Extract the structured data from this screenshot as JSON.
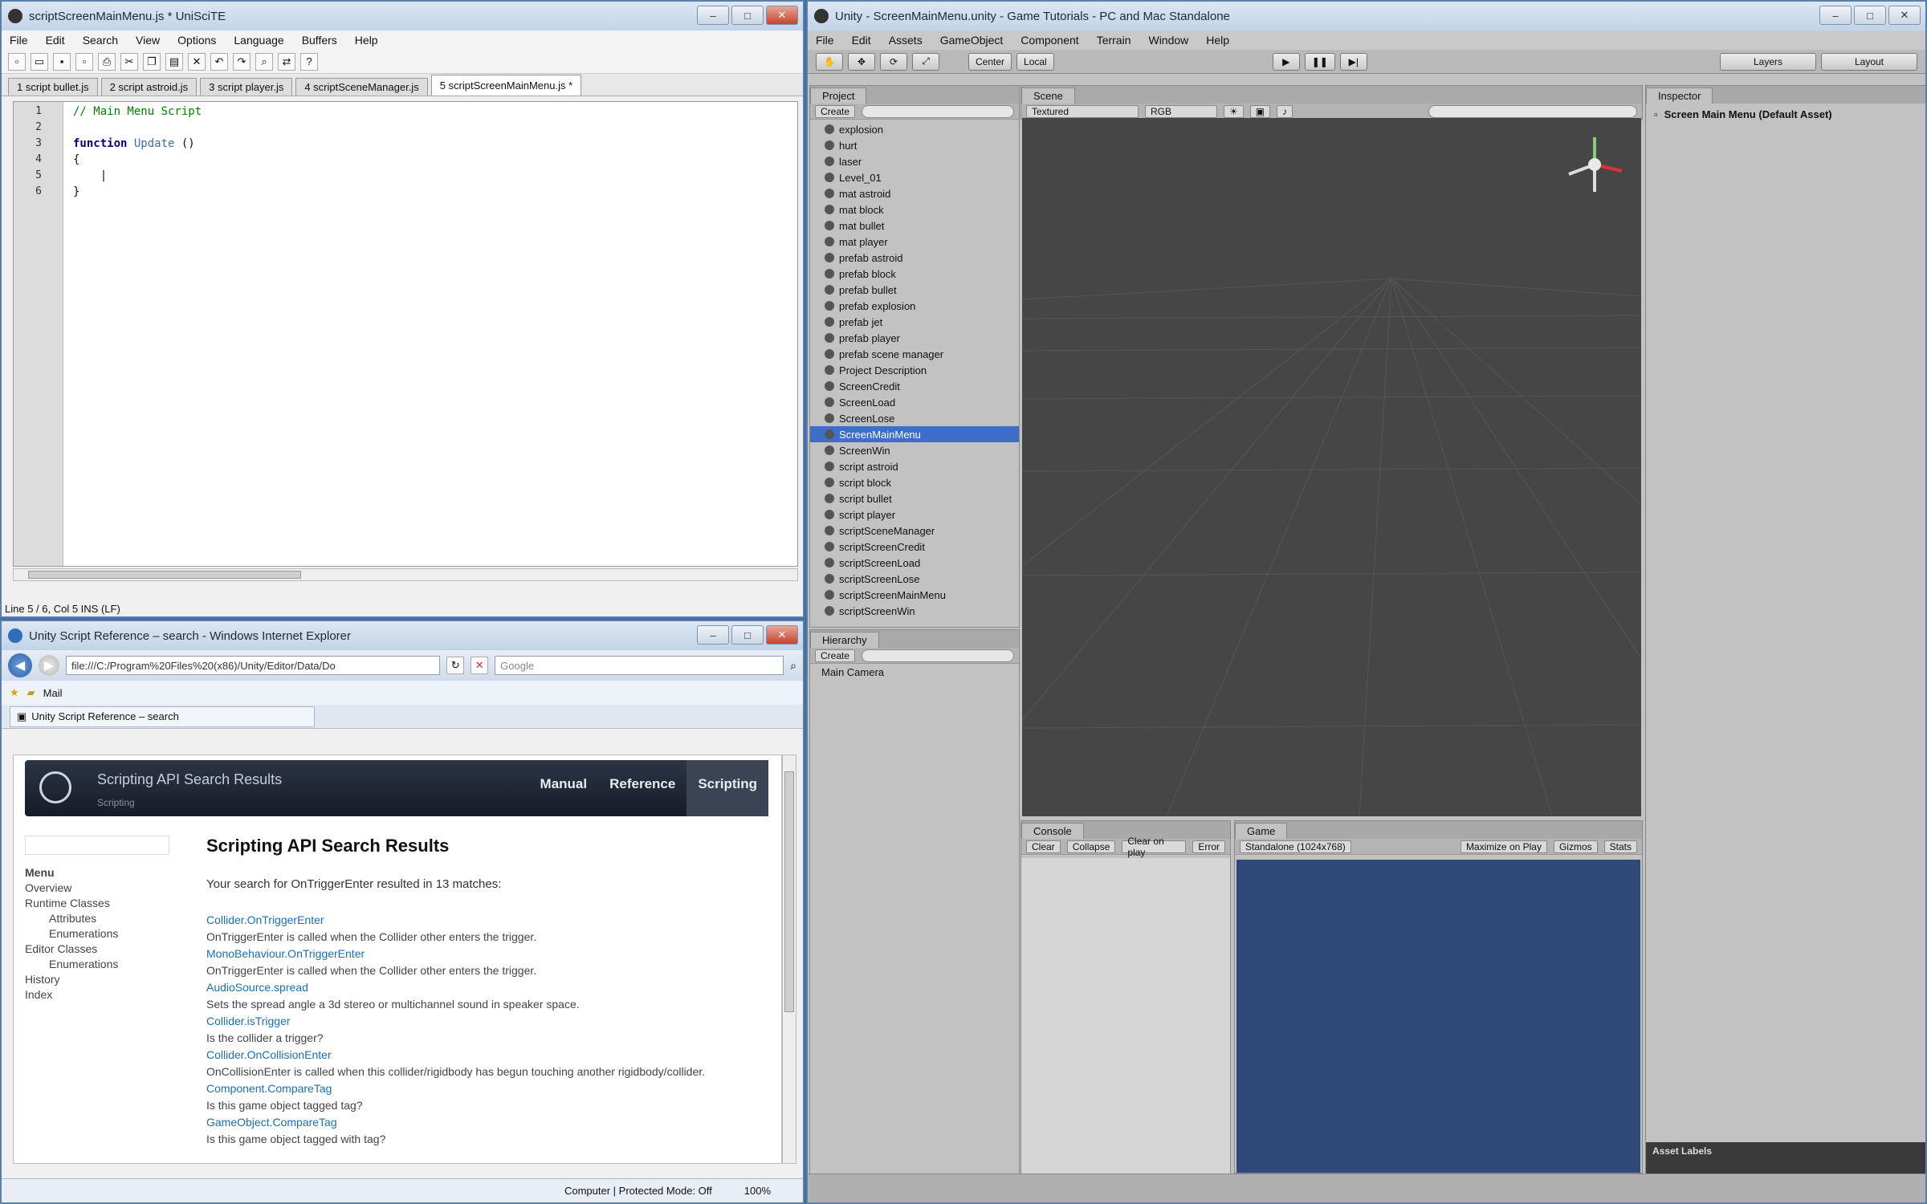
{
  "unisci": {
    "title": "scriptScreenMainMenu.js * UniSciTE",
    "menu": [
      "File",
      "Edit",
      "Search",
      "View",
      "Options",
      "Language",
      "Buffers",
      "Help"
    ],
    "tabs": [
      "1 script bullet.js",
      "2 script astroid.js",
      "3 script player.js",
      "4 scriptSceneManager.js",
      "5 scriptScreenMainMenu.js *"
    ],
    "line_numbers": [
      "1",
      "2",
      "3",
      "4",
      "5",
      "6"
    ],
    "code": {
      "comment": "// Main Menu Script",
      "kw": "function",
      "fn": "Update",
      "parens": " ()",
      "open": "{",
      "close": "}"
    },
    "status": "Line 5 / 6, Col 5  INS (LF)"
  },
  "unity": {
    "title": "Unity - ScreenMainMenu.unity - Game Tutorials - PC and Mac Standalone",
    "menu": [
      "File",
      "Edit",
      "Assets",
      "GameObject",
      "Component",
      "Terrain",
      "Window",
      "Help"
    ],
    "toolbar": {
      "center": "Center",
      "local": "Local",
      "layers": "Layers",
      "layout": "Layout"
    },
    "project": {
      "tab": "Project",
      "create": "Create",
      "items": [
        "explosion",
        "hurt",
        "laser",
        "Level_01",
        "mat astroid",
        "mat block",
        "mat bullet",
        "mat player",
        "prefab astroid",
        "prefab block",
        "prefab bullet",
        "prefab explosion",
        "prefab jet",
        "prefab player",
        "prefab scene manager",
        "Project Description",
        "ScreenCredit",
        "ScreenLoad",
        "ScreenLose",
        "ScreenMainMenu",
        "ScreenWin",
        "script astroid",
        "script block",
        "script bullet",
        "script player",
        "scriptSceneManager",
        "scriptScreenCredit",
        "scriptScreenLoad",
        "scriptScreenLose",
        "scriptScreenMainMenu",
        "scriptScreenWin"
      ],
      "selected_index": 19
    },
    "hierarchy": {
      "tab": "Hierarchy",
      "create": "Create",
      "items": [
        "Main Camera"
      ]
    },
    "scene": {
      "tab": "Scene",
      "shading": "Textured",
      "mode": "RGB"
    },
    "inspector": {
      "tab": "Inspector",
      "object": "Screen Main Menu (Default Asset)",
      "asset_labels": "Asset Labels"
    },
    "console": {
      "tab": "Console",
      "buttons": [
        "Clear",
        "Collapse",
        "Clear on play",
        "Error"
      ]
    },
    "game": {
      "tab": "Game",
      "aspect": "Standalone (1024x768)",
      "buttons": [
        "Maximize on Play",
        "Gizmos",
        "Stats"
      ]
    },
    "colors": {
      "scene_bg": "#464646",
      "game_bg": "#2f4a78",
      "selection": "#3d6ec9"
    }
  },
  "ie": {
    "title": "Unity Script Reference – search - Windows Internet Explorer",
    "address": "file:///C:/Program%20Files%20(x86)/Unity/Editor/Data/Do",
    "search_placeholder": "Google",
    "fav": "Mail",
    "tab": "Unity Script Reference – search",
    "banner": {
      "title": "Scripting API Search Results",
      "subtitle": "Scripting",
      "nav": [
        "Manual",
        "Reference",
        "Scripting"
      ]
    },
    "sidebar": [
      "Menu",
      "Overview",
      "Runtime Classes",
      "Attributes",
      "Enumerations",
      "Editor Classes",
      "Enumerations",
      "History",
      "Index"
    ],
    "heading": "Scripting API Search Results",
    "query": "Your search for OnTriggerEnter resulted in 13 matches:",
    "results": [
      {
        "link": "Collider.OnTriggerEnter",
        "desc": "OnTriggerEnter is called when the Collider other enters the trigger."
      },
      {
        "link": "MonoBehaviour.OnTriggerEnter",
        "desc": "OnTriggerEnter is called when the Collider other enters the trigger."
      },
      {
        "link": "AudioSource.spread",
        "desc": "Sets the spread angle a 3d stereo or multichannel sound in speaker space."
      },
      {
        "link": "Collider.isTrigger",
        "desc": "Is the collider a trigger?"
      },
      {
        "link": "Collider.OnCollisionEnter",
        "desc": "OnCollisionEnter is called when this collider/rigidbody has begun touching another rigidbody/collider."
      },
      {
        "link": "Component.CompareTag",
        "desc": "Is this game object tagged tag?"
      },
      {
        "link": "GameObject.CompareTag",
        "desc": "Is this game object tagged with tag?"
      }
    ],
    "status": "Computer | Protected Mode: Off",
    "zoom": "100%"
  }
}
